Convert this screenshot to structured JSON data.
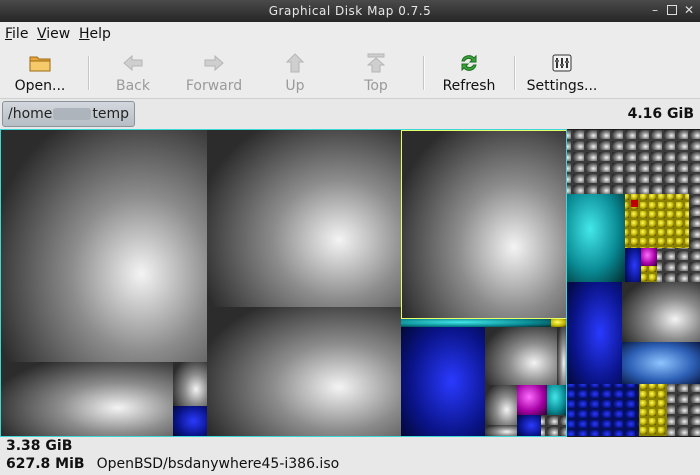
{
  "window": {
    "title": "Graphical Disk Map 0.7.5"
  },
  "menu": [
    {
      "accel": "F",
      "rest": "ile"
    },
    {
      "accel": "V",
      "rest": "iew"
    },
    {
      "accel": "H",
      "rest": "elp"
    }
  ],
  "toolbar": {
    "open": "Open...",
    "back": "Back",
    "forward": "Forward",
    "up": "Up",
    "top": "Top",
    "refresh": "Refresh",
    "settings": "Settings..."
  },
  "path": {
    "start": "/home",
    "end": "temp"
  },
  "total_size": "4.16 GiB",
  "status": {
    "selected_size": "3.38 GiB",
    "hover_size": "627.8 MiB",
    "hover_file": "OpenBSD/bsdanywhere45-i386.iso"
  }
}
